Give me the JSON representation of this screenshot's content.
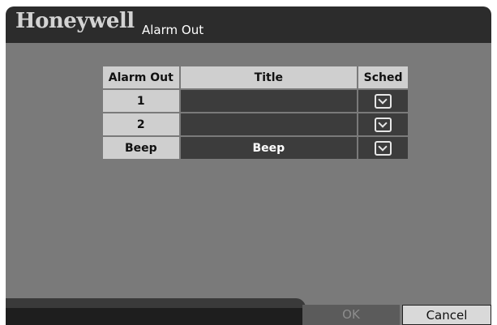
{
  "header": {
    "brand": "Honeywell",
    "title": "Alarm Out"
  },
  "table": {
    "columns": [
      "Alarm Out",
      "Title",
      "Sched"
    ],
    "rows": [
      {
        "label": "1",
        "title": "",
        "sched_icon": "schedule-check-icon"
      },
      {
        "label": "2",
        "title": "",
        "sched_icon": "schedule-check-icon"
      },
      {
        "label": "Beep",
        "title": "Beep",
        "sched_icon": "schedule-check-icon"
      }
    ]
  },
  "buttons": {
    "ok": "OK",
    "cancel": "Cancel"
  },
  "colors": {
    "panel_bg": "#7a7a7a",
    "header_bg": "#2c2c2c",
    "cell_dark": "#3c3c3c",
    "cell_light": "#cfcfcf"
  }
}
